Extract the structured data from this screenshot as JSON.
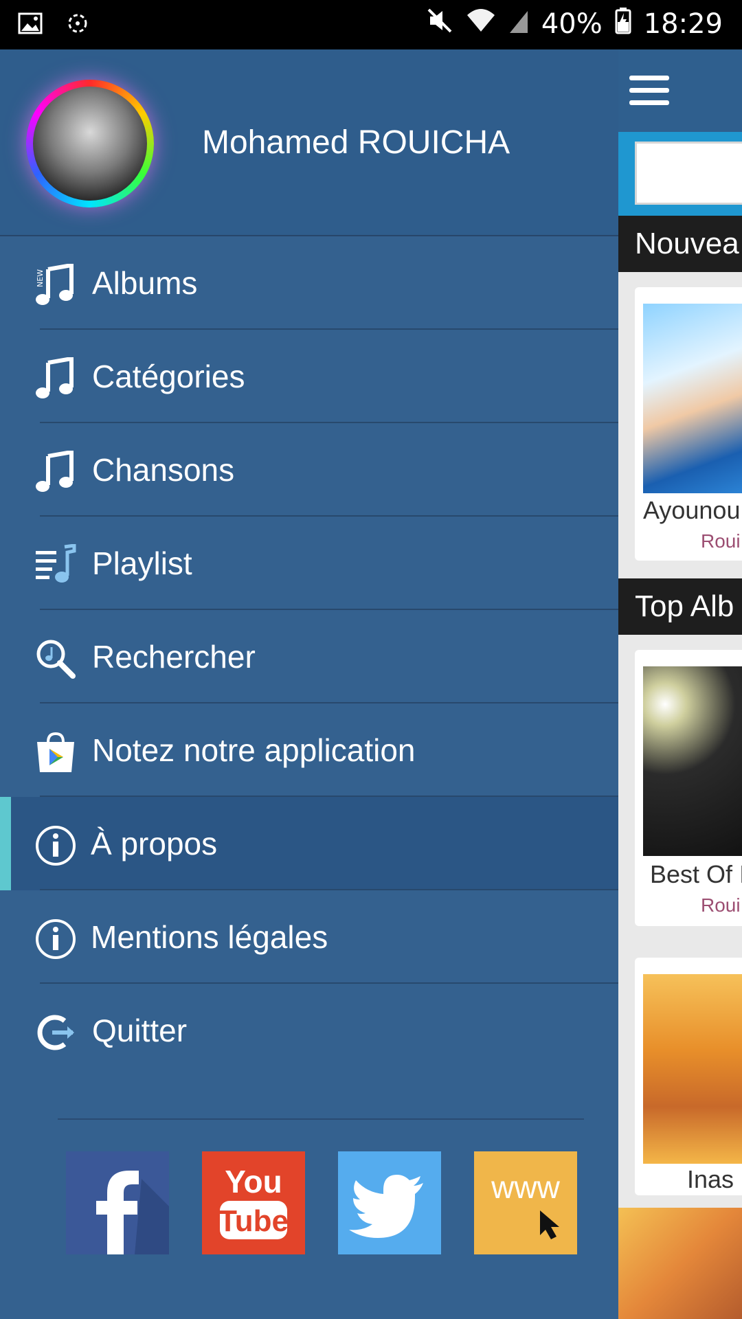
{
  "status_bar": {
    "battery": "40%",
    "time": "18:29"
  },
  "drawer": {
    "title": "Mohamed ROUICHA",
    "items": [
      {
        "label": "Albums",
        "icon": "music-note-new-icon"
      },
      {
        "label": "Catégories",
        "icon": "music-note-icon"
      },
      {
        "label": "Chansons",
        "icon": "music-note-icon"
      },
      {
        "label": "Playlist",
        "icon": "playlist-icon"
      },
      {
        "label": "Rechercher",
        "icon": "search-music-icon"
      },
      {
        "label": "Notez notre application",
        "icon": "play-store-icon"
      },
      {
        "label": "À propos",
        "icon": "info-icon",
        "active": true
      },
      {
        "label": "Mentions légales",
        "icon": "info-icon"
      },
      {
        "label": "Quitter",
        "icon": "exit-icon"
      }
    ],
    "social": [
      {
        "name": "facebook",
        "icon": "facebook-icon",
        "color": "#3b5898"
      },
      {
        "name": "youtube",
        "icon": "youtube-icon",
        "color": "#e2442a",
        "text_top": "You",
        "text_bottom": "Tube"
      },
      {
        "name": "twitter",
        "icon": "twitter-icon",
        "color": "#55acee"
      },
      {
        "name": "website",
        "icon": "www-icon",
        "color": "#f0b64a",
        "text": "www"
      }
    ]
  },
  "content": {
    "section_new": "Nouvea",
    "section_top": "Top Alb",
    "cards": [
      {
        "title": "Ayounou",
        "artist": "Roui"
      },
      {
        "title": "Best Of I",
        "artist": "Roui"
      },
      {
        "title": "Inas",
        "artist": ""
      }
    ]
  },
  "colors": {
    "drawer_bg": "#34618f",
    "active_accent": "#5ec8cf",
    "header_bar": "#1e1e1e",
    "search_bar": "#1f97d0"
  }
}
